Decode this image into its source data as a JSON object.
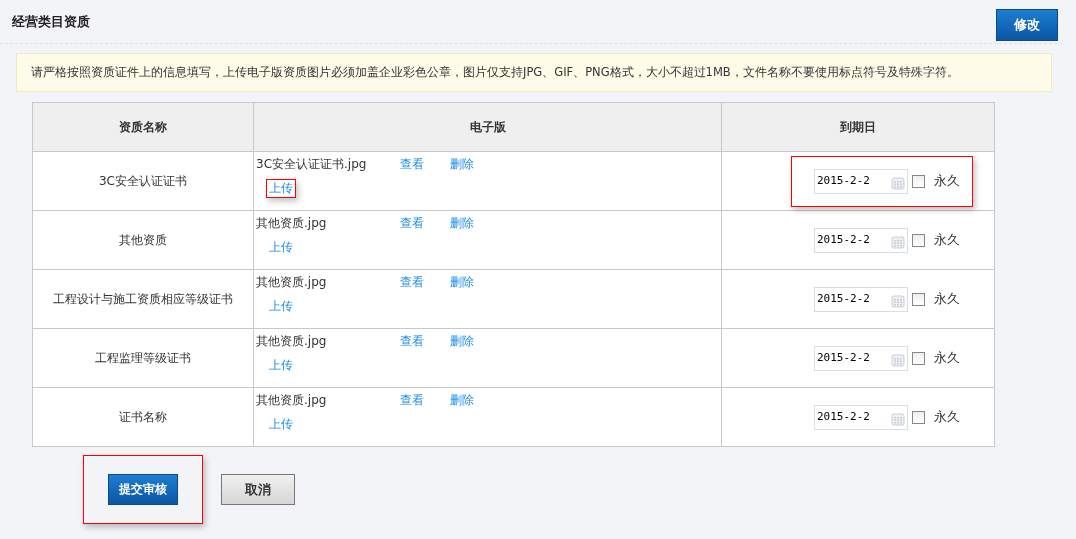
{
  "header": {
    "title": "经营类目资质",
    "edit_button": "修改"
  },
  "notice": "请严格按照资质证件上的信息填写，上传电子版资质图片必须加盖企业彩色公章，图片仅支持JPG、GIF、PNG格式，大小不超过1MB，文件名称不要使用标点符号及特殊字符。",
  "table": {
    "columns": [
      "资质名称",
      "电子版",
      "到期日"
    ],
    "rows": [
      {
        "name": "3C安全认证证书",
        "file": "3C安全认证证书.jpg",
        "view": "查看",
        "delete": "删除",
        "upload": "上传",
        "upload_highlighted": true,
        "date": "2015-2-2",
        "date_highlighted": true,
        "permanent": "永久",
        "checked": false
      },
      {
        "name": "其他资质",
        "file": "其他资质.jpg",
        "view": "查看",
        "delete": "删除",
        "upload": "上传",
        "upload_highlighted": false,
        "date": "2015-2-2",
        "date_highlighted": false,
        "permanent": "永久",
        "checked": false
      },
      {
        "name": "工程设计与施工资质相应等级证书",
        "file": "其他资质.jpg",
        "view": "查看",
        "delete": "删除",
        "upload": "上传",
        "upload_highlighted": false,
        "date": "2015-2-2",
        "date_highlighted": false,
        "permanent": "永久",
        "checked": false
      },
      {
        "name": "工程监理等级证书",
        "file": "其他资质.jpg",
        "view": "查看",
        "delete": "删除",
        "upload": "上传",
        "upload_highlighted": false,
        "date": "2015-2-2",
        "date_highlighted": false,
        "permanent": "永久",
        "checked": false
      },
      {
        "name": "证书名称",
        "file": "其他资质.jpg",
        "view": "查看",
        "delete": "删除",
        "upload": "上传",
        "upload_highlighted": false,
        "date": "2015-2-2",
        "date_highlighted": false,
        "permanent": "永久",
        "checked": false
      }
    ]
  },
  "footer": {
    "submit": {
      "label": "提交审核",
      "highlighted": true
    },
    "cancel": "取消"
  }
}
